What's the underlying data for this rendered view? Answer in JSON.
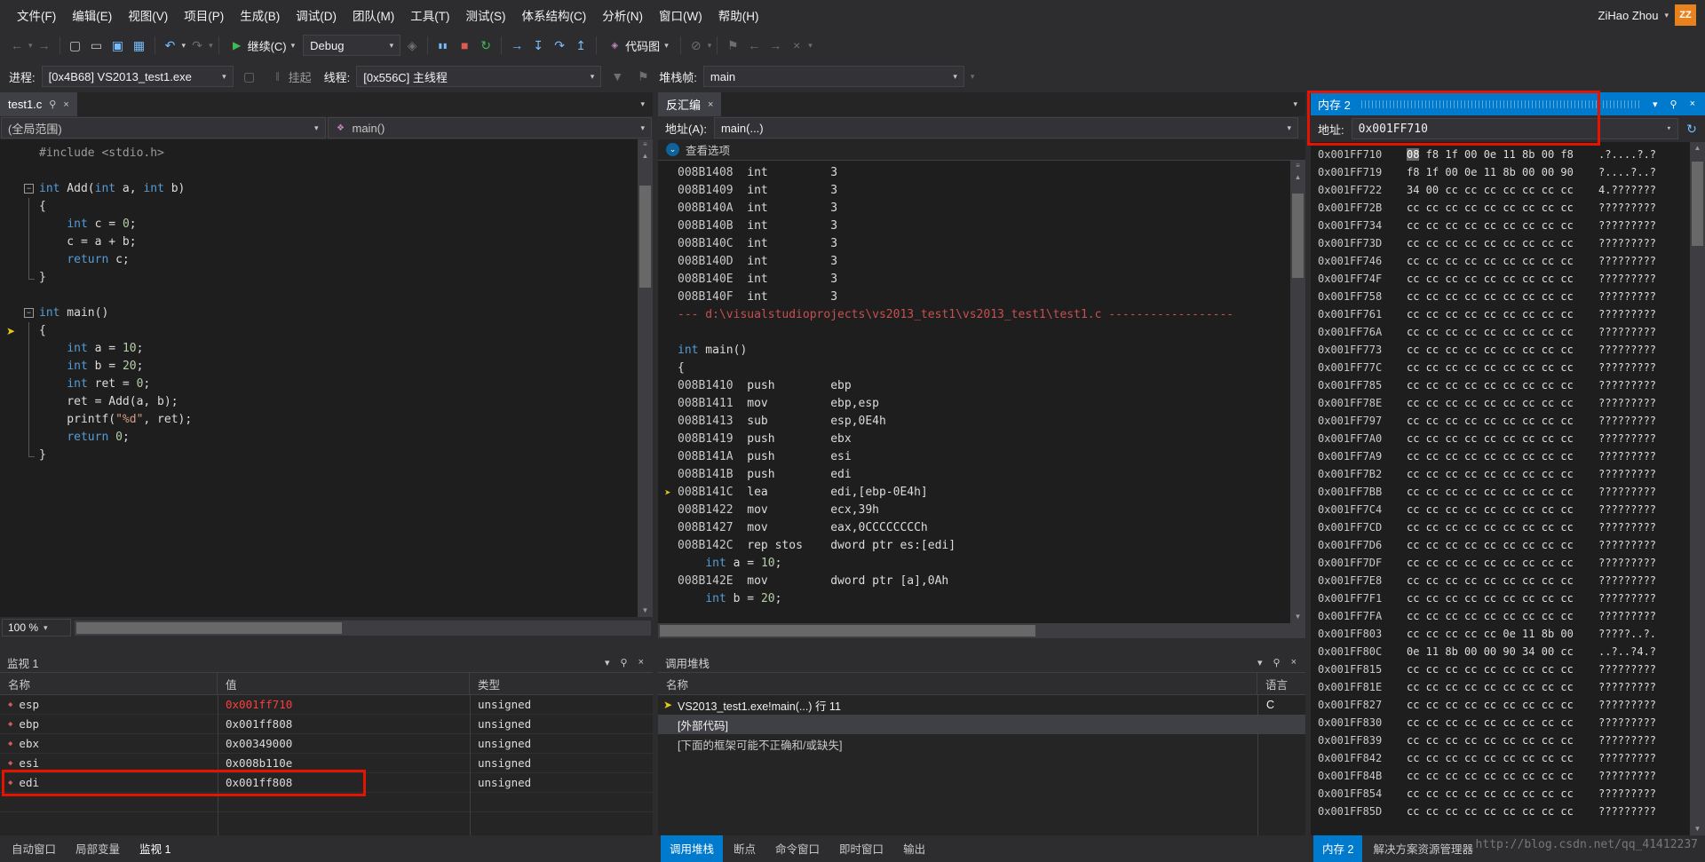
{
  "menu": {
    "items": [
      "文件(F)",
      "编辑(E)",
      "视图(V)",
      "项目(P)",
      "生成(B)",
      "调试(D)",
      "团队(M)",
      "工具(T)",
      "测试(S)",
      "体系结构(C)",
      "分析(N)",
      "窗口(W)",
      "帮助(H)"
    ]
  },
  "user": {
    "name": "ZiHao Zhou",
    "avatar": "ZZ"
  },
  "toolbar": {
    "continue_label": "继续(C)",
    "debug_combo": "Debug",
    "codemap_label": "代码图"
  },
  "debugbar": {
    "process_label": "进程:",
    "process_value": "[0x4B68] VS2013_test1.exe",
    "suspend_label": "挂起",
    "thread_label": "线程:",
    "thread_value": "[0x556C] 主线程",
    "frame_label": "堆栈帧:",
    "frame_value": "main"
  },
  "editor": {
    "tab": "test1.c",
    "scope_combo": "(全局范围)",
    "function_combo": "main()",
    "zoom": "100 %",
    "lines": [
      {
        "text": "#include <stdio.h>",
        "fold": ""
      },
      {
        "text": "",
        "fold": ""
      },
      {
        "text": "int Add(int a, int b)",
        "fold": "start"
      },
      {
        "text": "{",
        "fold": "mid"
      },
      {
        "text": "    int c = 0;",
        "fold": "mid"
      },
      {
        "text": "    c = a + b;",
        "fold": "mid"
      },
      {
        "text": "    return c;",
        "fold": "mid"
      },
      {
        "text": "}",
        "fold": "end"
      },
      {
        "text": "",
        "fold": ""
      },
      {
        "text": "int main()",
        "fold": "start"
      },
      {
        "text": "{",
        "fold": "mid",
        "current": true
      },
      {
        "text": "    int a = 10;",
        "fold": "mid"
      },
      {
        "text": "    int b = 20;",
        "fold": "mid"
      },
      {
        "text": "    int ret = 0;",
        "fold": "mid"
      },
      {
        "text": "    ret = Add(a, b);",
        "fold": "mid"
      },
      {
        "text": "    printf(\"%d\", ret);",
        "fold": "mid"
      },
      {
        "text": "    return 0;",
        "fold": "mid"
      },
      {
        "text": "}",
        "fold": "end"
      }
    ]
  },
  "disasm": {
    "tab": "反汇编",
    "address_label": "地址(A):",
    "address_value": "main(...)",
    "options_label": "查看选项",
    "lines": [
      {
        "t": "asm",
        "a": "008B1408",
        "m": "int",
        "o": "3"
      },
      {
        "t": "asm",
        "a": "008B1409",
        "m": "int",
        "o": "3"
      },
      {
        "t": "asm",
        "a": "008B140A",
        "m": "int",
        "o": "3"
      },
      {
        "t": "asm",
        "a": "008B140B",
        "m": "int",
        "o": "3"
      },
      {
        "t": "asm",
        "a": "008B140C",
        "m": "int",
        "o": "3"
      },
      {
        "t": "asm",
        "a": "008B140D",
        "m": "int",
        "o": "3"
      },
      {
        "t": "asm",
        "a": "008B140E",
        "m": "int",
        "o": "3"
      },
      {
        "t": "asm",
        "a": "008B140F",
        "m": "int",
        "o": "3"
      },
      {
        "t": "sep",
        "text": "--- d:\\visualstudioprojects\\vs2013_test1\\vs2013_test1\\test1.c ------------------"
      },
      {
        "t": "src",
        "text": ""
      },
      {
        "t": "src",
        "text": "int main()"
      },
      {
        "t": "src",
        "text": "{"
      },
      {
        "t": "asm",
        "a": "008B1410",
        "m": "push",
        "o": "ebp"
      },
      {
        "t": "asm",
        "a": "008B1411",
        "m": "mov",
        "o": "ebp,esp"
      },
      {
        "t": "asm",
        "a": "008B1413",
        "m": "sub",
        "o": "esp,0E4h"
      },
      {
        "t": "asm",
        "a": "008B1419",
        "m": "push",
        "o": "ebx"
      },
      {
        "t": "asm",
        "a": "008B141A",
        "m": "push",
        "o": "esi"
      },
      {
        "t": "asm",
        "a": "008B141B",
        "m": "push",
        "o": "edi"
      },
      {
        "t": "asm",
        "a": "008B141C",
        "m": "lea",
        "o": "edi,[ebp-0E4h]",
        "current": true
      },
      {
        "t": "asm",
        "a": "008B1422",
        "m": "mov",
        "o": "ecx,39h"
      },
      {
        "t": "asm",
        "a": "008B1427",
        "m": "mov",
        "o": "eax,0CCCCCCCCh"
      },
      {
        "t": "asm",
        "a": "008B142C",
        "m": "rep stos",
        "o": "dword ptr es:[edi]"
      },
      {
        "t": "src",
        "text": "    int a = 10;"
      },
      {
        "t": "asm",
        "a": "008B142E",
        "m": "mov",
        "o": "dword ptr [a],0Ah"
      },
      {
        "t": "src",
        "text": "    int b = 20;"
      }
    ]
  },
  "memory": {
    "title": "内存 2",
    "address_label": "地址:",
    "address_value": "0x001FF710",
    "rows": [
      {
        "addr": "0x001FF710",
        "bytes": "08 f8 1f 00 0e 11 8b 00 f8",
        "ascii": ".?....?.?",
        "cursor": true
      },
      {
        "addr": "0x001FF719",
        "bytes": "f8 1f 00 0e 11 8b 00 00 90",
        "ascii": "?....?..?"
      },
      {
        "addr": "0x001FF722",
        "bytes": "34 00 cc cc cc cc cc cc cc",
        "ascii": "4.???????"
      },
      {
        "addr": "0x001FF72B",
        "bytes": "cc cc cc cc cc cc cc cc cc",
        "ascii": "?????????"
      },
      {
        "addr": "0x001FF734",
        "bytes": "cc cc cc cc cc cc cc cc cc",
        "ascii": "?????????"
      },
      {
        "addr": "0x001FF73D",
        "bytes": "cc cc cc cc cc cc cc cc cc",
        "ascii": "?????????"
      },
      {
        "addr": "0x001FF746",
        "bytes": "cc cc cc cc cc cc cc cc cc",
        "ascii": "?????????"
      },
      {
        "addr": "0x001FF74F",
        "bytes": "cc cc cc cc cc cc cc cc cc",
        "ascii": "?????????"
      },
      {
        "addr": "0x001FF758",
        "bytes": "cc cc cc cc cc cc cc cc cc",
        "ascii": "?????????"
      },
      {
        "addr": "0x001FF761",
        "bytes": "cc cc cc cc cc cc cc cc cc",
        "ascii": "?????????"
      },
      {
        "addr": "0x001FF76A",
        "bytes": "cc cc cc cc cc cc cc cc cc",
        "ascii": "?????????"
      },
      {
        "addr": "0x001FF773",
        "bytes": "cc cc cc cc cc cc cc cc cc",
        "ascii": "?????????"
      },
      {
        "addr": "0x001FF77C",
        "bytes": "cc cc cc cc cc cc cc cc cc",
        "ascii": "?????????"
      },
      {
        "addr": "0x001FF785",
        "bytes": "cc cc cc cc cc cc cc cc cc",
        "ascii": "?????????"
      },
      {
        "addr": "0x001FF78E",
        "bytes": "cc cc cc cc cc cc cc cc cc",
        "ascii": "?????????"
      },
      {
        "addr": "0x001FF797",
        "bytes": "cc cc cc cc cc cc cc cc cc",
        "ascii": "?????????"
      },
      {
        "addr": "0x001FF7A0",
        "bytes": "cc cc cc cc cc cc cc cc cc",
        "ascii": "?????????"
      },
      {
        "addr": "0x001FF7A9",
        "bytes": "cc cc cc cc cc cc cc cc cc",
        "ascii": "?????????"
      },
      {
        "addr": "0x001FF7B2",
        "bytes": "cc cc cc cc cc cc cc cc cc",
        "ascii": "?????????"
      },
      {
        "addr": "0x001FF7BB",
        "bytes": "cc cc cc cc cc cc cc cc cc",
        "ascii": "?????????"
      },
      {
        "addr": "0x001FF7C4",
        "bytes": "cc cc cc cc cc cc cc cc cc",
        "ascii": "?????????"
      },
      {
        "addr": "0x001FF7CD",
        "bytes": "cc cc cc cc cc cc cc cc cc",
        "ascii": "?????????"
      },
      {
        "addr": "0x001FF7D6",
        "bytes": "cc cc cc cc cc cc cc cc cc",
        "ascii": "?????????"
      },
      {
        "addr": "0x001FF7DF",
        "bytes": "cc cc cc cc cc cc cc cc cc",
        "ascii": "?????????"
      },
      {
        "addr": "0x001FF7E8",
        "bytes": "cc cc cc cc cc cc cc cc cc",
        "ascii": "?????????"
      },
      {
        "addr": "0x001FF7F1",
        "bytes": "cc cc cc cc cc cc cc cc cc",
        "ascii": "?????????"
      },
      {
        "addr": "0x001FF7FA",
        "bytes": "cc cc cc cc cc cc cc cc cc",
        "ascii": "?????????"
      },
      {
        "addr": "0x001FF803",
        "bytes": "cc cc cc cc cc 0e 11 8b 00",
        "ascii": "?????..?."
      },
      {
        "addr": "0x001FF80C",
        "bytes": "0e 11 8b 00 00 90 34 00 cc",
        "ascii": "..?..?4.?"
      },
      {
        "addr": "0x001FF815",
        "bytes": "cc cc cc cc cc cc cc cc cc",
        "ascii": "?????????"
      },
      {
        "addr": "0x001FF81E",
        "bytes": "cc cc cc cc cc cc cc cc cc",
        "ascii": "?????????"
      },
      {
        "addr": "0x001FF827",
        "bytes": "cc cc cc cc cc cc cc cc cc",
        "ascii": "?????????"
      },
      {
        "addr": "0x001FF830",
        "bytes": "cc cc cc cc cc cc cc cc cc",
        "ascii": "?????????"
      },
      {
        "addr": "0x001FF839",
        "bytes": "cc cc cc cc cc cc cc cc cc",
        "ascii": "?????????"
      },
      {
        "addr": "0x001FF842",
        "bytes": "cc cc cc cc cc cc cc cc cc",
        "ascii": "?????????"
      },
      {
        "addr": "0x001FF84B",
        "bytes": "cc cc cc cc cc cc cc cc cc",
        "ascii": "?????????"
      },
      {
        "addr": "0x001FF854",
        "bytes": "cc cc cc cc cc cc cc cc cc",
        "ascii": "?????????"
      },
      {
        "addr": "0x001FF85D",
        "bytes": "cc cc cc cc cc cc cc cc cc",
        "ascii": "?????????"
      }
    ]
  },
  "watch": {
    "title": "监视 1",
    "columns": [
      "名称",
      "值",
      "类型"
    ],
    "rows": [
      {
        "name": "esp",
        "value": "0x001ff710",
        "type": "unsigned",
        "changed": true
      },
      {
        "name": "ebp",
        "value": "0x001ff808",
        "type": "unsigned"
      },
      {
        "name": "ebx",
        "value": "0x00349000",
        "type": "unsigned"
      },
      {
        "name": "esi",
        "value": "0x008b110e",
        "type": "unsigned"
      },
      {
        "name": "edi",
        "value": "0x001ff808",
        "type": "unsigned",
        "annotated": true
      },
      {
        "name": "",
        "value": "",
        "type": ""
      }
    ]
  },
  "callstack": {
    "title": "调用堆栈",
    "columns": [
      "名称",
      "语言"
    ],
    "rows": [
      {
        "name": "VS2013_test1.exe!main(...) 行 11",
        "lang": "C",
        "current": true
      },
      {
        "name": "[外部代码]",
        "lang": "",
        "selected": true
      },
      {
        "name": "[下面的框架可能不正确和/或缺失]",
        "lang": "",
        "dim": true
      }
    ]
  },
  "bottom_tabs": {
    "left": [
      {
        "label": "自动窗口"
      },
      {
        "label": "局部变量"
      },
      {
        "label": "监视 1",
        "highlight": true
      }
    ],
    "middle": [
      {
        "label": "调用堆栈",
        "active": true
      },
      {
        "label": "断点"
      },
      {
        "label": "命令窗口"
      },
      {
        "label": "即时窗口"
      },
      {
        "label": "输出"
      }
    ],
    "right": [
      {
        "label": "内存 2",
        "active": true
      },
      {
        "label": "解决方案资源管理器"
      }
    ]
  },
  "watermark": "http://blog.csdn.net/qq_41412237",
  "icons": {
    "back": "←",
    "forward": "→",
    "new_file": "▢",
    "open": "▭",
    "save": "▣",
    "save_all": "▦",
    "undo": "↶",
    "redo": "↷",
    "play": "▶",
    "pause": "▮▮",
    "stop": "■",
    "restart": "↻",
    "show_next": "→",
    "step_into": "↧",
    "step_over": "↷",
    "step_out": "↥",
    "codemap": "◈",
    "flag": "⚑",
    "filter": "▼",
    "pin": "⚲",
    "close": "×",
    "dropdown": "▾",
    "refresh": "↻",
    "method": "❖",
    "current_arrow": "➤",
    "watch_variable": "◆",
    "fold_collapse": "−",
    "expander": "⌄",
    "grip": "≡",
    "up_arrow": "▲",
    "down_arrow": "▼",
    "suspend": "∥",
    "disable": "⊘"
  },
  "colors": {
    "accent": "#007acc",
    "annotation": "#e51400",
    "changed_value": "#ff3d3d",
    "avatar": "#e8821e"
  }
}
